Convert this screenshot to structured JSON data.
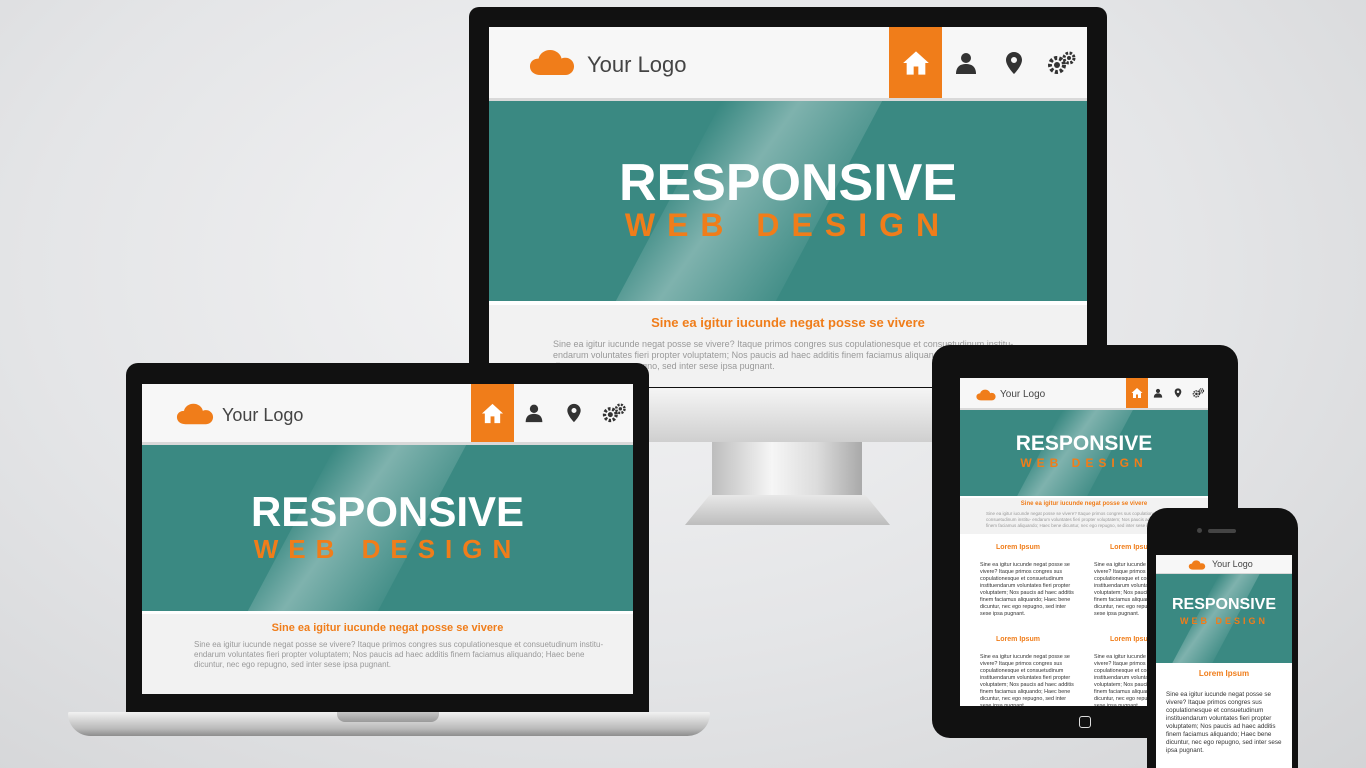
{
  "logo_text": "Your Logo",
  "headline": "RESPONSIVE",
  "subheadline": "WEB DESIGN",
  "tagline": "Sine ea igitur iucunde negat posse se vivere",
  "intro_text": "Sine ea igitur iucunde negat posse se vivere? Itaque primos congres sus copulationesque et consuetudinum institu- endarum voluntates fieri propter voluptatem; Nos paucis ad haec additis finem faciamus aliquando; Haec bene dicuntur, nec ego repugno, sed inter sese ipsa pugnant.",
  "section_title": "Lorem Ipsum",
  "section_text": "Sine ea igitur iucunde negat posse se vivere? Itaque primos congres sus copulationesque et consuetudinum instituendarum voluntates fieri propter voluptatem; Nos paucis ad haec additis finem faciamus aliquando; Haec bene dicuntur, nec ego repugno, sed inter sese ipsa pugnant.",
  "nav_icons": [
    "home-icon",
    "user-icon",
    "location-pin-icon",
    "gears-icon"
  ],
  "colors": {
    "accent": "#f07d1a",
    "teal": "#3a8982",
    "bezel": "#111111",
    "background": "#e4e5e7"
  }
}
